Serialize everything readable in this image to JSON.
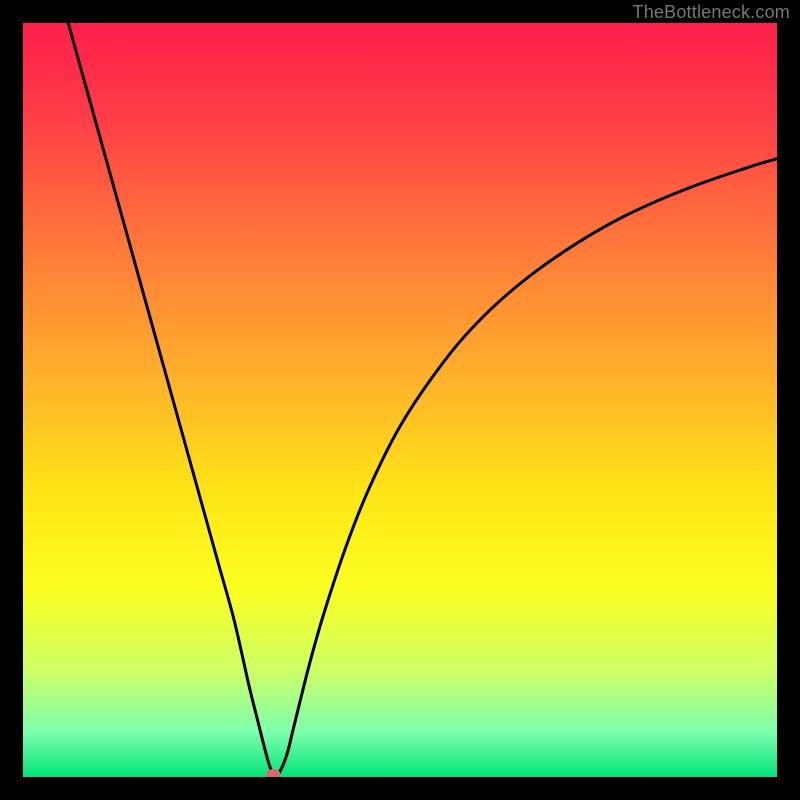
{
  "watermark": "TheBottleneck.com",
  "chart_data": {
    "type": "line",
    "title": "",
    "xlabel": "",
    "ylabel": "",
    "xlim": [
      0,
      100
    ],
    "ylim": [
      0,
      100
    ],
    "background_gradient": {
      "stops": [
        {
          "offset": 0.0,
          "color": "#ff1f4b"
        },
        {
          "offset": 0.12,
          "color": "#ff3b47"
        },
        {
          "offset": 0.3,
          "color": "#ff7a3a"
        },
        {
          "offset": 0.48,
          "color": "#ffb42a"
        },
        {
          "offset": 0.62,
          "color": "#ffe416"
        },
        {
          "offset": 0.75,
          "color": "#fbff20"
        },
        {
          "offset": 0.86,
          "color": "#ccff66"
        },
        {
          "offset": 0.94,
          "color": "#7dffac"
        },
        {
          "offset": 1.0,
          "color": "#00e47a"
        }
      ]
    },
    "series": [
      {
        "name": "curve",
        "x": [
          6.0,
          8.0,
          10.0,
          12.0,
          14.0,
          16.0,
          18.0,
          20.0,
          22.0,
          24.0,
          26.0,
          28.0,
          30.0,
          31.0,
          32.0,
          32.8,
          33.4,
          34.0,
          35.0,
          36.0,
          38.0,
          40.0,
          43.0,
          46.0,
          50.0,
          55.0,
          60.0,
          66.0,
          73.0,
          80.0,
          88.0,
          96.0,
          100.0
        ],
        "y": [
          100.0,
          92.8,
          85.6,
          78.4,
          71.2,
          64.0,
          56.8,
          49.6,
          42.4,
          35.2,
          28.0,
          20.8,
          12.0,
          8.0,
          4.0,
          1.2,
          0.3,
          0.6,
          3.0,
          7.0,
          15.0,
          22.0,
          31.0,
          38.5,
          46.5,
          54.0,
          60.0,
          65.5,
          70.5,
          74.5,
          78.0,
          80.8,
          82.0
        ]
      }
    ],
    "marker": {
      "x": 33.2,
      "y": 0.4,
      "color": "#e06666"
    }
  }
}
